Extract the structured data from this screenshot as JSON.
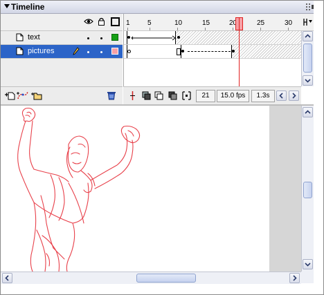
{
  "panel": {
    "title": "Timeline"
  },
  "layers": [
    {
      "name": "text",
      "selected": false,
      "outline_color": "#16a016"
    },
    {
      "name": "pictures",
      "selected": true,
      "outline_color": "#f7a0a5"
    }
  ],
  "ruler": {
    "labels": [
      "1",
      "5",
      "10",
      "15",
      "20",
      "25",
      "30"
    ]
  },
  "status": {
    "current_frame": "21",
    "frame_rate": "15.0 fps",
    "elapsed_time": "1.3s"
  },
  "icons": {
    "eye": "eye-icon",
    "lock": "lock-icon",
    "outline": "outline-icon",
    "insert_layer": "insert-layer-icon",
    "motion_guide": "add-motion-guide-icon",
    "insert_folder": "insert-folder-icon",
    "delete": "trash-icon"
  },
  "colors": {
    "selected_layer": "#2c64c8",
    "playhead": "#e02020",
    "drawing_stroke": "#e8404a"
  }
}
